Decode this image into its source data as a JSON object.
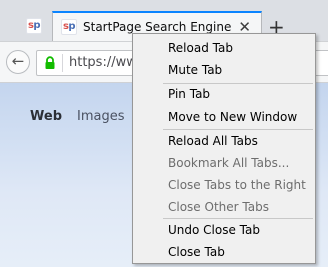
{
  "tabs": {
    "inactive": {
      "favicon": {
        "s": "s",
        "p": "p"
      }
    },
    "active": {
      "title": "StartPage Search Engine",
      "favicon": {
        "s": "s",
        "p": "p"
      },
      "close_glyph": "✕"
    },
    "new_tab_glyph": "+"
  },
  "navbar": {
    "back_glyph": "←",
    "url_text": "https://ww"
  },
  "page": {
    "links": [
      "Web",
      "Images"
    ]
  },
  "context_menu": {
    "items": [
      {
        "label": "Reload Tab",
        "enabled": true
      },
      {
        "label": "Mute Tab",
        "enabled": true
      },
      {
        "label": "Pin Tab",
        "enabled": true
      },
      {
        "label": "Move to New Window",
        "enabled": true
      },
      {
        "label": "Reload All Tabs",
        "enabled": true
      },
      {
        "label": "Bookmark All Tabs...",
        "enabled": false
      },
      {
        "label": "Close Tabs to the Right",
        "enabled": false
      },
      {
        "label": "Close Other Tabs",
        "enabled": false
      },
      {
        "label": "Undo Close Tab",
        "enabled": true
      },
      {
        "label": "Close Tab",
        "enabled": true
      }
    ]
  },
  "colors": {
    "accent": "#0a84ff",
    "lock": "#12bc00",
    "favicon_s": "#d9534f",
    "favicon_p": "#4a6fb5"
  }
}
